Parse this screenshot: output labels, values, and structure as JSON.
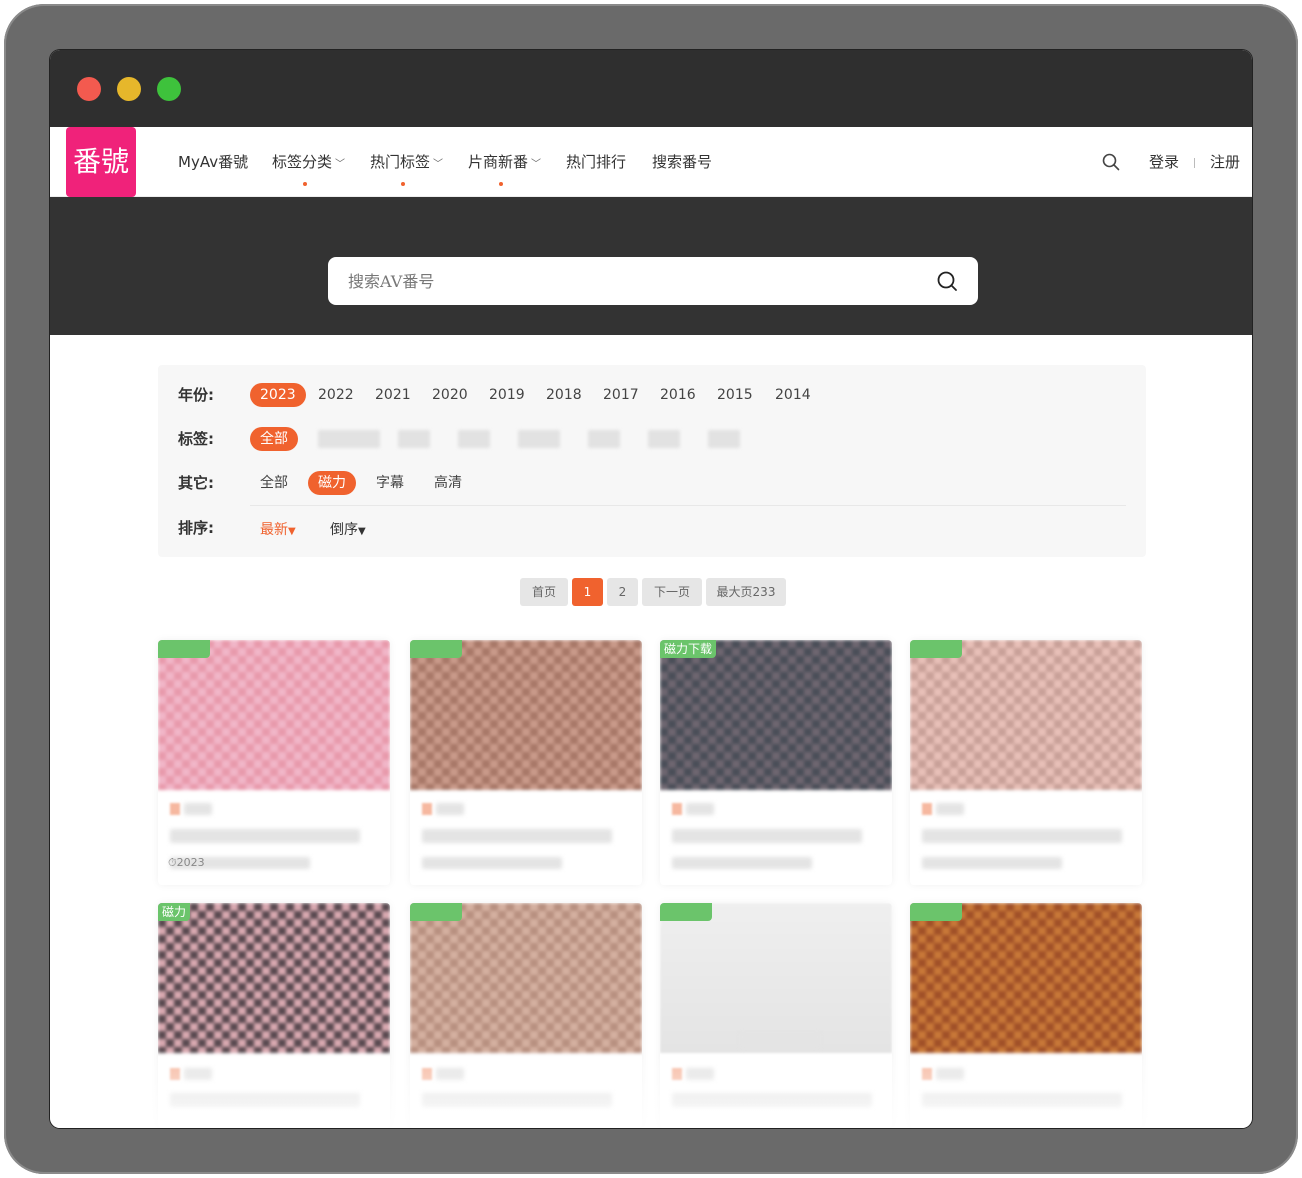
{
  "logo": {
    "text": "番號"
  },
  "nav": {
    "items": [
      {
        "label": "MyAv番號",
        "dropdown": false
      },
      {
        "label": "标签分类",
        "dropdown": true
      },
      {
        "label": "热门标签",
        "dropdown": true
      },
      {
        "label": "片商新番",
        "dropdown": true
      },
      {
        "label": "热门排行",
        "dropdown": false
      },
      {
        "label": "搜索番号",
        "dropdown": false
      }
    ],
    "login": "登录",
    "register": "注册"
  },
  "search": {
    "placeholder": "搜索AV番号"
  },
  "filters": {
    "year_label": "年份:",
    "years": [
      "2023",
      "2022",
      "2021",
      "2020",
      "2019",
      "2018",
      "2017",
      "2016",
      "2015",
      "2014"
    ],
    "year_active": "2023",
    "tag_label": "标签:",
    "tag_all": "全部",
    "other_label": "其它:",
    "other_options": [
      "全部",
      "磁力",
      "字幕",
      "高清"
    ],
    "other_active": "磁力",
    "sort_label": "排序:",
    "sort_options": [
      "最新",
      "倒序"
    ]
  },
  "pagination": {
    "first": "首页",
    "pages": [
      "1",
      "2"
    ],
    "current": "1",
    "next": "下一页",
    "last": "最大页233"
  },
  "cards": [
    {
      "badge": "",
      "date": "⏱2023"
    },
    {
      "badge": ""
    },
    {
      "badge": "磁力下载"
    },
    {
      "badge": ""
    },
    {
      "badge": "磁力"
    },
    {
      "badge": ""
    },
    {
      "badge": ""
    },
    {
      "badge": ""
    }
  ],
  "colors": {
    "accent": "#f0622e",
    "brand": "#f0227a",
    "hero": "#333333",
    "badge": "#6bc46b"
  }
}
